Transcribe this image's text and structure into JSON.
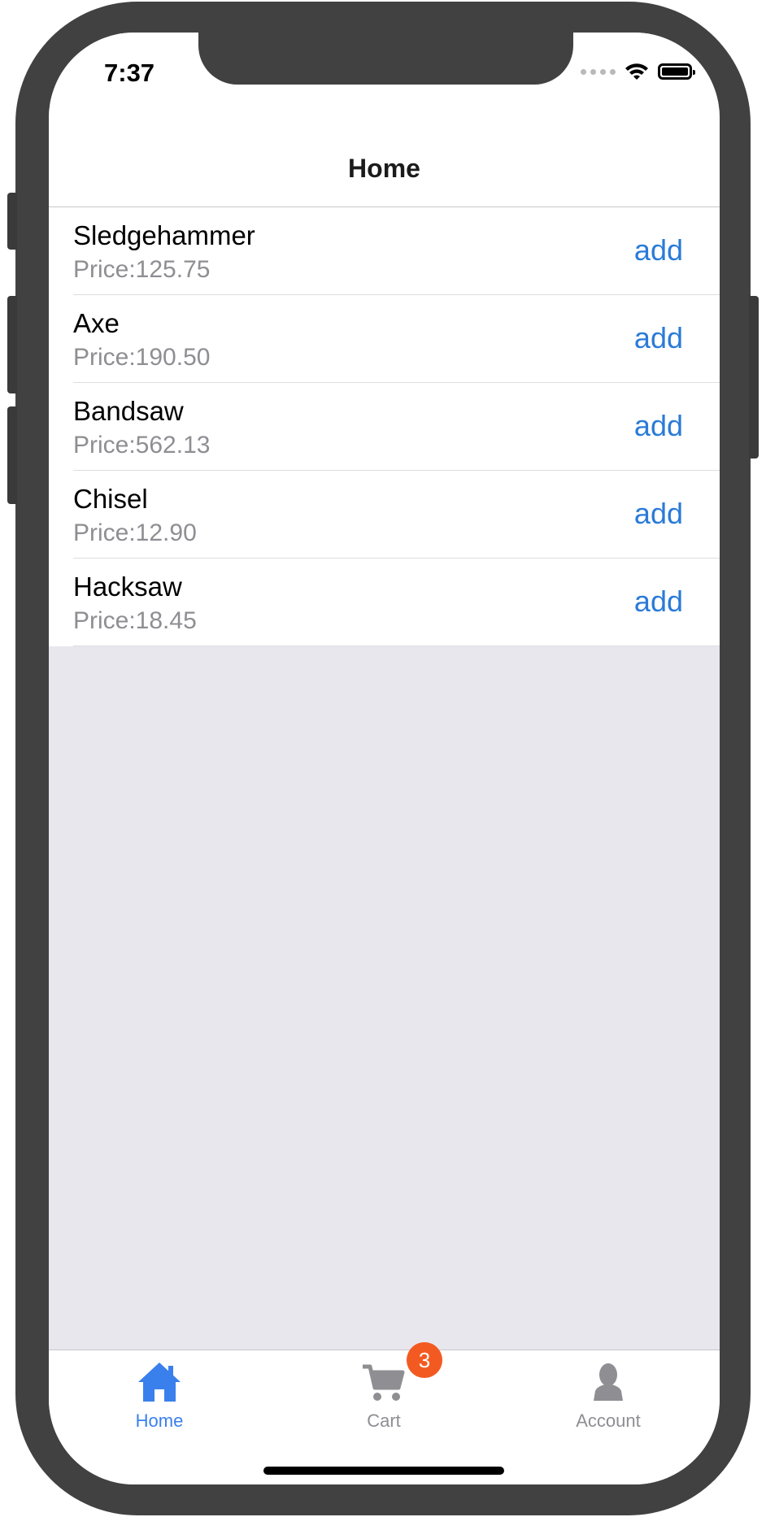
{
  "status_bar": {
    "time": "7:37"
  },
  "nav": {
    "title": "Home"
  },
  "products": [
    {
      "name": "Sledgehammer",
      "price": "Price:125.75",
      "action": "add"
    },
    {
      "name": "Axe",
      "price": "Price:190.50",
      "action": "add"
    },
    {
      "name": "Bandsaw",
      "price": "Price:562.13",
      "action": "add"
    },
    {
      "name": "Chisel",
      "price": "Price:12.90",
      "action": "add"
    },
    {
      "name": "Hacksaw",
      "price": "Price:18.45",
      "action": "add"
    }
  ],
  "tabs": [
    {
      "label": "Home",
      "icon": "home-icon",
      "active": true
    },
    {
      "label": "Cart",
      "icon": "cart-icon",
      "badge": "3"
    },
    {
      "label": "Account",
      "icon": "account-icon"
    }
  ],
  "colors": {
    "accent": "#2b7bd8",
    "tab_active": "#3a80ec",
    "tab_inactive": "#8e8e93",
    "badge": "#f35a22",
    "list_background": "#e8e7ed"
  }
}
